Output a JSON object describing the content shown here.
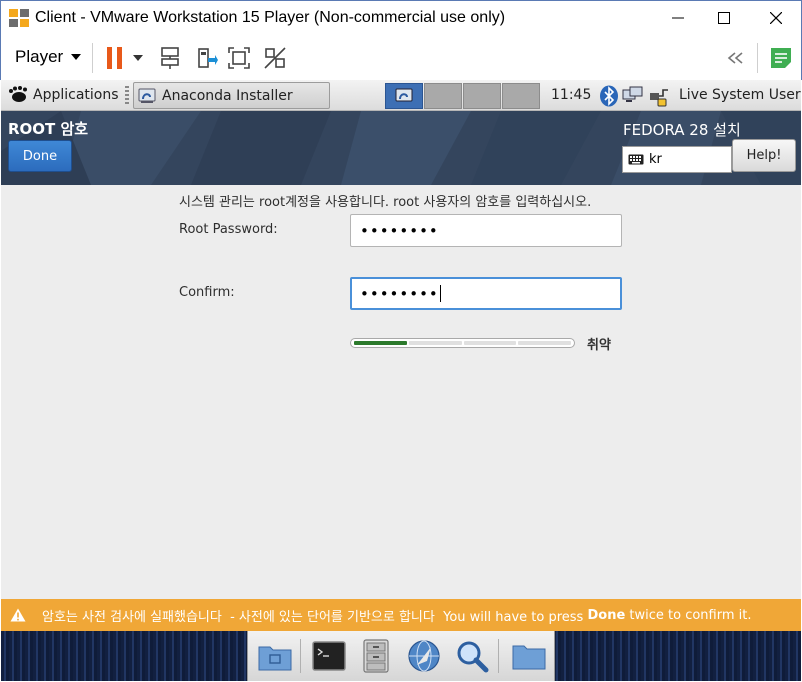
{
  "window": {
    "title": "Client - VMware Workstation 15 Player (Non-commercial use only)",
    "controls": [
      "minimize-icon",
      "maximize-icon",
      "close-icon"
    ]
  },
  "vmware_toolbar": {
    "player_label": "Player",
    "icons": [
      "pause-icon",
      "dropdown-arrow-icon",
      "network-adapter-icon",
      "removable-device-icon",
      "fit-guest-icon",
      "unity-icon",
      "collapse-icon",
      "notes-icon"
    ],
    "accent_pause": "#e8591a"
  },
  "gnome_panel": {
    "applications_label": "Applications",
    "task_label": "Anaconda Installer",
    "clock": "11:45",
    "user": "Live System User",
    "tray_icons": [
      "bluetooth-icon",
      "network-icon",
      "power-icon"
    ]
  },
  "anaconda": {
    "spoke_title": "ROOT 암호",
    "done_label": "Done",
    "product_title": "FEDORA 28 설치",
    "keyboard_layout": "kr",
    "help_label": "Help!",
    "header_color": "#34455d",
    "description": "시스템 관리는 root계정을 사용합니다. root 사용자의 암호를 입력하십시오.",
    "root_password_label": "Root Password:",
    "root_password_value": "••••••••",
    "confirm_label": "Confirm:",
    "confirm_value": "••••••••",
    "strength_label": "취약",
    "strength_fraction": 0.25,
    "warning_prefix": "암호는 사전 검사에 실패했습니다  - 사전에 있는 단어를 기반으로 합니다  You will have to press ",
    "warning_bold": "Done",
    "warning_suffix": " twice to confirm it.",
    "warning_color": "#f0a737"
  },
  "dock": {
    "icons": [
      "home-folder-icon",
      "terminal-icon",
      "file-cabinet-icon",
      "web-browser-icon",
      "search-icon",
      "folder-icon"
    ]
  }
}
